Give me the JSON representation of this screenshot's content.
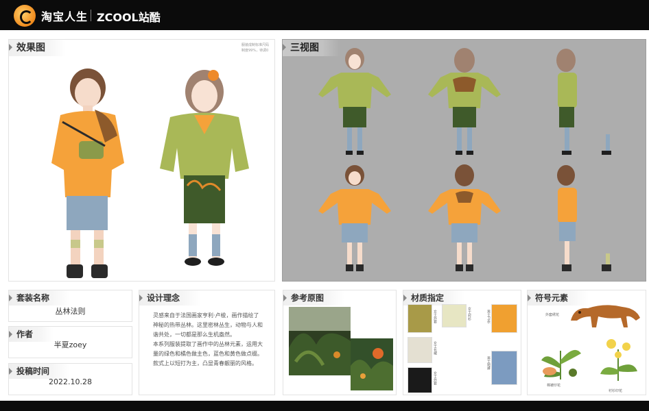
{
  "header": {
    "brand_primary": "淘宝人生",
    "brand_secondary": "ZCOOL站酷"
  },
  "effect_panel": {
    "title": "效果图",
    "note_line1": "服装成制标准尺码",
    "note_line2": "制度99%，待调0"
  },
  "three_view_panel": {
    "title": "三视图"
  },
  "outfit_name": {
    "label": "套装名称",
    "value": "丛林法则"
  },
  "author": {
    "label": "作者",
    "value": "半夏zoey"
  },
  "submit_date": {
    "label": "投稿时间",
    "value": "2022.10.28"
  },
  "design_concept": {
    "title": "设计理念",
    "paragraph1": "灵感来自于法国画家亨利·卢梭，画作描绘了神秘的热带丛林。这里密林丛生，动物与人和谐共处，一切都是那么生机盎然。",
    "paragraph2": "本系列服装提取了画作中的丛林元素，运用大量的绿色和橘色做主色，蓝色和黄色做点缀。款式上以短打为主，凸显青春靓丽的风格。"
  },
  "reference_panel": {
    "title": "参考原图"
  },
  "materials_panel": {
    "title": "材质指定",
    "labels": [
      "女士外套",
      "女士衬衫",
      "女士长裙",
      "女士外套",
      "男士卫衣",
      "男士短裤"
    ]
  },
  "symbols_panel": {
    "title": "符号元素",
    "captions": [
      "外套绣花",
      "棉被印花",
      "衬衫印花"
    ]
  },
  "colors": {
    "orange": "#f5a23a",
    "green": "#a9b857",
    "jungle": "#3f5a2a",
    "denim": "#8ea7be",
    "gray_panel": "#adadad"
  }
}
